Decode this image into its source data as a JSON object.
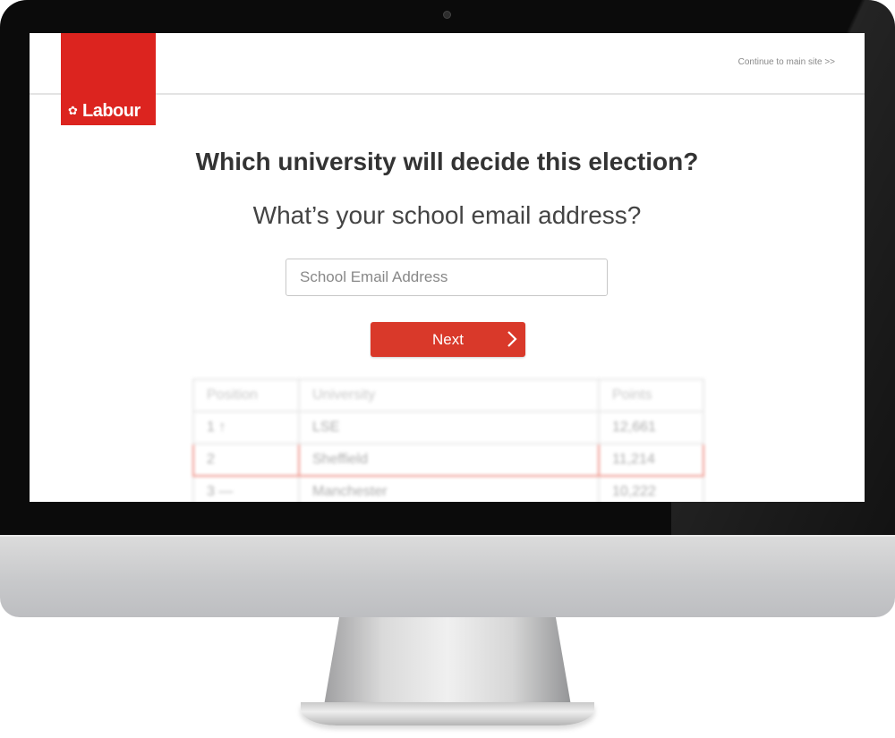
{
  "header": {
    "logo_text": "Labour",
    "continue_link": "Continue to main site >>"
  },
  "main": {
    "headline": "Which university will decide this election?",
    "subheading": "What’s your school email address?",
    "email_placeholder": "School Email Address",
    "next_label": "Next"
  },
  "leaderboard": {
    "columns": [
      "Position",
      "University",
      "Points"
    ],
    "rows": [
      {
        "position": "1 ↑",
        "university": "LSE",
        "points": "12,661"
      },
      {
        "position": "2",
        "university": "Sheffield",
        "points": "11,214"
      },
      {
        "position": "3 —",
        "university": "Manchester",
        "points": "10,222"
      }
    ],
    "highlighted_row": 1
  },
  "colors": {
    "brand_red": "#dc241f",
    "button_red": "#d9392a",
    "bezel": "#0b0b0b"
  },
  "icons": [
    "rose-icon",
    "chevron-right-icon"
  ]
}
